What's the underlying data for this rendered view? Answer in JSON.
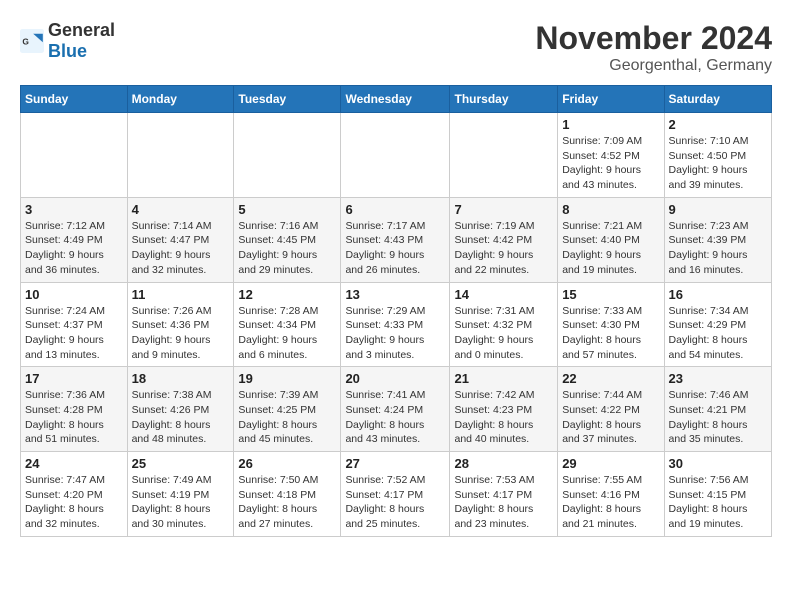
{
  "logo": {
    "general": "General",
    "blue": "Blue"
  },
  "title": "November 2024",
  "location": "Georgenthal, Germany",
  "weekdays": [
    "Sunday",
    "Monday",
    "Tuesday",
    "Wednesday",
    "Thursday",
    "Friday",
    "Saturday"
  ],
  "weeks": [
    [
      {
        "day": "",
        "info": ""
      },
      {
        "day": "",
        "info": ""
      },
      {
        "day": "",
        "info": ""
      },
      {
        "day": "",
        "info": ""
      },
      {
        "day": "",
        "info": ""
      },
      {
        "day": "1",
        "info": "Sunrise: 7:09 AM\nSunset: 4:52 PM\nDaylight: 9 hours\nand 43 minutes."
      },
      {
        "day": "2",
        "info": "Sunrise: 7:10 AM\nSunset: 4:50 PM\nDaylight: 9 hours\nand 39 minutes."
      }
    ],
    [
      {
        "day": "3",
        "info": "Sunrise: 7:12 AM\nSunset: 4:49 PM\nDaylight: 9 hours\nand 36 minutes."
      },
      {
        "day": "4",
        "info": "Sunrise: 7:14 AM\nSunset: 4:47 PM\nDaylight: 9 hours\nand 32 minutes."
      },
      {
        "day": "5",
        "info": "Sunrise: 7:16 AM\nSunset: 4:45 PM\nDaylight: 9 hours\nand 29 minutes."
      },
      {
        "day": "6",
        "info": "Sunrise: 7:17 AM\nSunset: 4:43 PM\nDaylight: 9 hours\nand 26 minutes."
      },
      {
        "day": "7",
        "info": "Sunrise: 7:19 AM\nSunset: 4:42 PM\nDaylight: 9 hours\nand 22 minutes."
      },
      {
        "day": "8",
        "info": "Sunrise: 7:21 AM\nSunset: 4:40 PM\nDaylight: 9 hours\nand 19 minutes."
      },
      {
        "day": "9",
        "info": "Sunrise: 7:23 AM\nSunset: 4:39 PM\nDaylight: 9 hours\nand 16 minutes."
      }
    ],
    [
      {
        "day": "10",
        "info": "Sunrise: 7:24 AM\nSunset: 4:37 PM\nDaylight: 9 hours\nand 13 minutes."
      },
      {
        "day": "11",
        "info": "Sunrise: 7:26 AM\nSunset: 4:36 PM\nDaylight: 9 hours\nand 9 minutes."
      },
      {
        "day": "12",
        "info": "Sunrise: 7:28 AM\nSunset: 4:34 PM\nDaylight: 9 hours\nand 6 minutes."
      },
      {
        "day": "13",
        "info": "Sunrise: 7:29 AM\nSunset: 4:33 PM\nDaylight: 9 hours\nand 3 minutes."
      },
      {
        "day": "14",
        "info": "Sunrise: 7:31 AM\nSunset: 4:32 PM\nDaylight: 9 hours\nand 0 minutes."
      },
      {
        "day": "15",
        "info": "Sunrise: 7:33 AM\nSunset: 4:30 PM\nDaylight: 8 hours\nand 57 minutes."
      },
      {
        "day": "16",
        "info": "Sunrise: 7:34 AM\nSunset: 4:29 PM\nDaylight: 8 hours\nand 54 minutes."
      }
    ],
    [
      {
        "day": "17",
        "info": "Sunrise: 7:36 AM\nSunset: 4:28 PM\nDaylight: 8 hours\nand 51 minutes."
      },
      {
        "day": "18",
        "info": "Sunrise: 7:38 AM\nSunset: 4:26 PM\nDaylight: 8 hours\nand 48 minutes."
      },
      {
        "day": "19",
        "info": "Sunrise: 7:39 AM\nSunset: 4:25 PM\nDaylight: 8 hours\nand 45 minutes."
      },
      {
        "day": "20",
        "info": "Sunrise: 7:41 AM\nSunset: 4:24 PM\nDaylight: 8 hours\nand 43 minutes."
      },
      {
        "day": "21",
        "info": "Sunrise: 7:42 AM\nSunset: 4:23 PM\nDaylight: 8 hours\nand 40 minutes."
      },
      {
        "day": "22",
        "info": "Sunrise: 7:44 AM\nSunset: 4:22 PM\nDaylight: 8 hours\nand 37 minutes."
      },
      {
        "day": "23",
        "info": "Sunrise: 7:46 AM\nSunset: 4:21 PM\nDaylight: 8 hours\nand 35 minutes."
      }
    ],
    [
      {
        "day": "24",
        "info": "Sunrise: 7:47 AM\nSunset: 4:20 PM\nDaylight: 8 hours\nand 32 minutes."
      },
      {
        "day": "25",
        "info": "Sunrise: 7:49 AM\nSunset: 4:19 PM\nDaylight: 8 hours\nand 30 minutes."
      },
      {
        "day": "26",
        "info": "Sunrise: 7:50 AM\nSunset: 4:18 PM\nDaylight: 8 hours\nand 27 minutes."
      },
      {
        "day": "27",
        "info": "Sunrise: 7:52 AM\nSunset: 4:17 PM\nDaylight: 8 hours\nand 25 minutes."
      },
      {
        "day": "28",
        "info": "Sunrise: 7:53 AM\nSunset: 4:17 PM\nDaylight: 8 hours\nand 23 minutes."
      },
      {
        "day": "29",
        "info": "Sunrise: 7:55 AM\nSunset: 4:16 PM\nDaylight: 8 hours\nand 21 minutes."
      },
      {
        "day": "30",
        "info": "Sunrise: 7:56 AM\nSunset: 4:15 PM\nDaylight: 8 hours\nand 19 minutes."
      }
    ]
  ]
}
